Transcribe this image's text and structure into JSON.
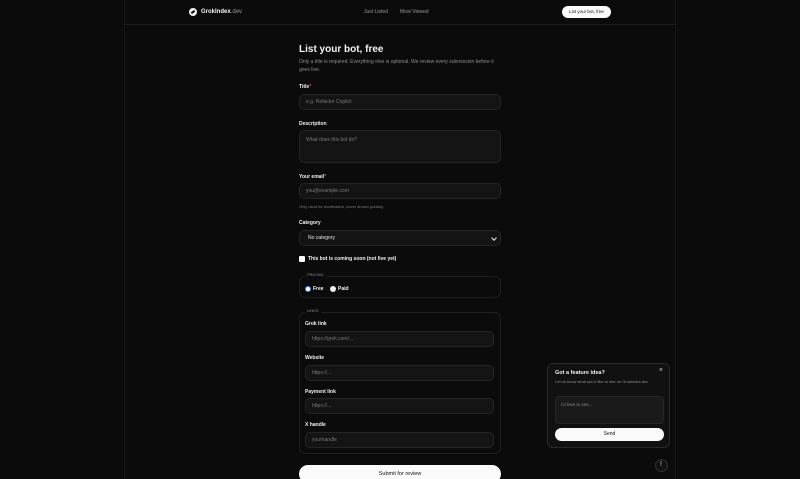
{
  "brand": {
    "name": "GrokIndex",
    "suffix": ".dev"
  },
  "nav": {
    "just_listed": "Just Listed",
    "most_viewed": "Most Viewed",
    "cta": "List your bot, free"
  },
  "form": {
    "title": "List your bot, free",
    "intro": "Only a title is required. Everything else is optional. We review every submission before it goes live.",
    "title_label": "Title",
    "title_placeholder": "e.g. Refactor Copilot",
    "description_label": "Description",
    "description_placeholder": "What does this bot do?",
    "email_label": "Your email",
    "email_placeholder": "you@example.com",
    "email_hint": "Only used for moderation, never shown publicly.",
    "category_label": "Category",
    "category_value": "No category",
    "coming_soon_label": "This bot is coming soon (not live yet)",
    "pricing_legend": "PRICING",
    "pricing_free": "Free",
    "pricing_paid": "Paid",
    "links_legend": "LINKS",
    "grok_label": "Grok link",
    "grok_placeholder": "https://grok.com/...",
    "website_label": "Website",
    "website_placeholder": "https://...",
    "payment_label": "Payment link",
    "payment_placeholder": "https://...",
    "x_label": "X handle",
    "x_placeholder": "yourhandle",
    "submit": "Submit for review"
  },
  "feedback": {
    "title": "Got a feature idea?",
    "subtitle": "Let us know what you'd like to see on GrokIndex.dev",
    "placeholder": "I'd love to see...",
    "send": "Send"
  }
}
